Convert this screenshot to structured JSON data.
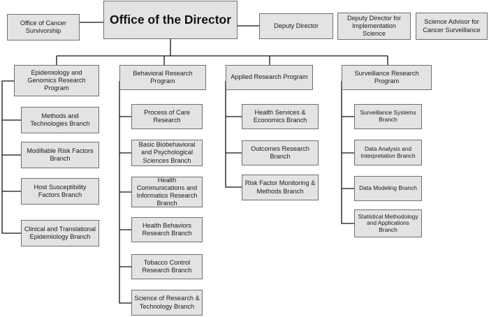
{
  "director": {
    "label": "Office of the Director"
  },
  "staff": {
    "survivorship": "Office of Cancer Survivorship",
    "deputy": "Deputy Director",
    "implementation": "Deputy Director for Implementation Science",
    "surveillance_advisor": "Science Advisor for Cancer Surveillance"
  },
  "programs": {
    "epidemiology": {
      "label": "Epidemiology and Genomics Research Program",
      "branches": [
        "Methods and Technologies Branch",
        "Modifiable Risk Factors Branch",
        "Host Susceptibility Factors Branch",
        "Clinical and Translational Epidemiology Branch"
      ]
    },
    "behavioral": {
      "label": "Behavioral Research Program",
      "branches": [
        "Process of Care Research",
        "Basic Biobehavioral and Psychological Sciences Branch",
        "Health Communications and Informatics Research Branch",
        "Health Behaviors Research Branch",
        "Tobacco Control Research Branch",
        "Science of Research & Technology Branch"
      ]
    },
    "applied": {
      "label": "Applied Research Program",
      "branches": [
        "Health Services & Economics Branch",
        "Outcomes Research Branch",
        "Risk Factor Monitoring & Methods Branch"
      ]
    },
    "surveillance": {
      "label": "Surveillance Research Program",
      "branches": [
        "Surveillance Systems Branch",
        "Data Analysis and Interpretation Branch",
        "Data Modeling Branch",
        "Statistical Methodology and Applications Branch"
      ]
    }
  }
}
